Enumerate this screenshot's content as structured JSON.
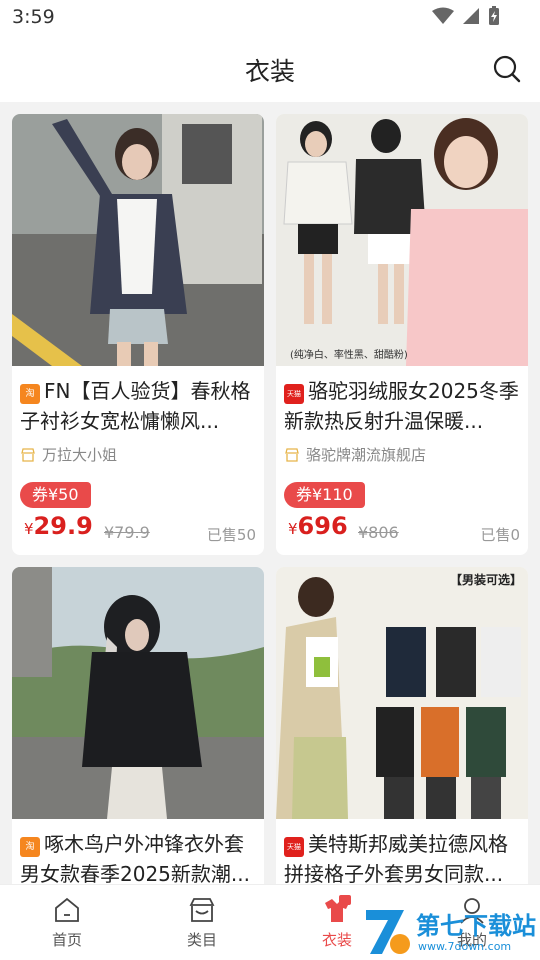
{
  "status": {
    "time": "3:59"
  },
  "header": {
    "title": "衣装"
  },
  "products": [
    {
      "platform": "淘",
      "title": "FN【百人验货】春秋格子衬衫女宽松慵懒风...",
      "shop": "万拉大小姐",
      "coupon": "券¥50",
      "currency": "¥",
      "price": "29.9",
      "original_price": "¥79.9",
      "sold": "已售50"
    },
    {
      "platform": "天猫",
      "title": "骆驼羽绒服女2025冬季新款热反射升温保暖...",
      "shop": "骆驼牌潮流旗舰店",
      "coupon": "券¥110",
      "currency": "¥",
      "price": "696",
      "original_price": "¥806",
      "sold": "已售0",
      "image_caption": "(纯净白、率性黑、甜酷粉)"
    },
    {
      "platform": "淘",
      "title": "啄木鸟户外冲锋衣外套男女款春季2025新款潮..."
    },
    {
      "platform": "天猫",
      "title": "美特斯邦威美拉德风格拼接格子外套男女同款...",
      "image_caption": "【男装可选】"
    }
  ],
  "tabbar": {
    "items": [
      {
        "label": "首页"
      },
      {
        "label": "类目"
      },
      {
        "label": "衣装",
        "active": true
      },
      {
        "label": "我的"
      }
    ]
  },
  "watermark": {
    "text": "第七下载站",
    "url": "www.7down.com"
  },
  "colors": {
    "accent": "#e94a4a",
    "price": "#d9201e",
    "taobao": "#f5861f",
    "tmall": "#e0211d"
  }
}
